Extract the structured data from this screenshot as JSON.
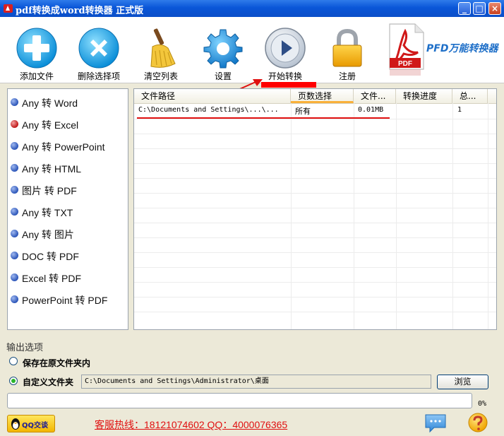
{
  "window": {
    "title": "pdf转换成word转换器 正式版",
    "minimize_icon": "minimize-icon",
    "maximize_icon": "maximize-icon",
    "close_icon": "close-icon"
  },
  "toolbar": {
    "add_label": "添加文件",
    "delete_label": "删除选择项",
    "clear_label": "清空列表",
    "settings_label": "设置",
    "start_label": "开始转换",
    "register_label": "注册",
    "pdf_badge": "PDF",
    "brand_text": "PFD万能转换器"
  },
  "modes": [
    {
      "label": "Any 转 Word",
      "color": "#2B55B8"
    },
    {
      "label": "Any 转 Excel",
      "color": "#C01818"
    },
    {
      "label": "Any 转 PowerPoint",
      "color": "#2B55B8"
    },
    {
      "label": "Any 转 HTML",
      "color": "#2B55B8"
    },
    {
      "label": "图片 转 PDF",
      "color": "#2B55B8"
    },
    {
      "label": "Any 转 TXT",
      "color": "#2B55B8"
    },
    {
      "label": "Any 转 图片",
      "color": "#2B55B8"
    },
    {
      "label": "DOC 转 PDF",
      "color": "#2B55B8"
    },
    {
      "label": "Excel 转 PDF",
      "color": "#2B55B8"
    },
    {
      "label": "PowerPoint 转 PDF",
      "color": "#2B55B8"
    }
  ],
  "table": {
    "headers": [
      "文件路径",
      "页数选择",
      "文件...",
      "转换进度",
      "总..."
    ],
    "rows": [
      [
        "C:\\Documents and Settings\\...\\...",
        "所有",
        "0.01MB",
        "",
        "1"
      ]
    ]
  },
  "output": {
    "title": "输出选项",
    "option_original": "保存在原文件夹内",
    "option_custom": "自定义文件夹",
    "custom_path": "C:\\Documents and Settings\\Administrator\\桌面",
    "browse_label": "浏览",
    "progress_text": "0%",
    "progress_fraction": 0
  },
  "footer": {
    "qq_label": "QQ交谈",
    "hotline": "客服热线：18121074602 QQ：4000076365"
  }
}
